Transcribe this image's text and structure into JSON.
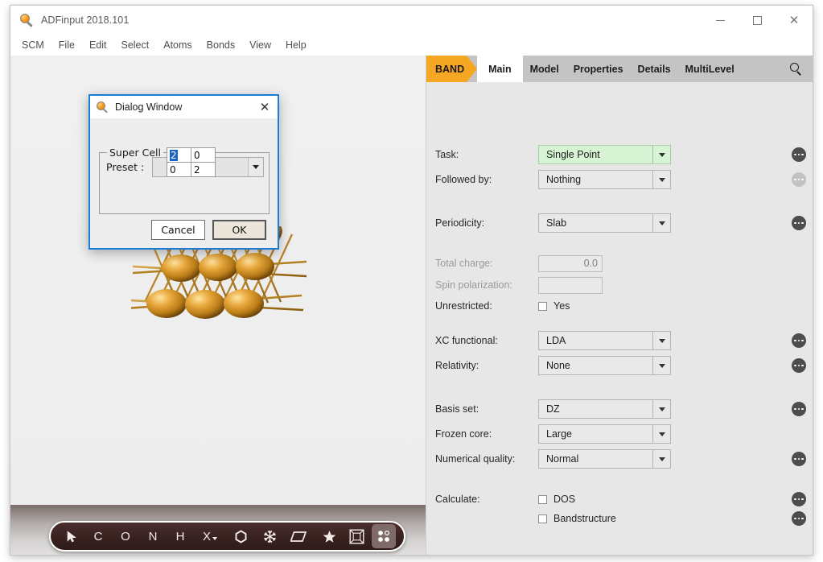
{
  "window": {
    "title": "ADFinput 2018.101",
    "icon": "magnifier-icon",
    "controls": {
      "minimize": "minimize-icon",
      "maximize": "maximize-icon",
      "close": "close-icon"
    }
  },
  "menubar": {
    "items": [
      {
        "label": "SCM"
      },
      {
        "label": "File"
      },
      {
        "label": "Edit"
      },
      {
        "label": "Select"
      },
      {
        "label": "Atoms"
      },
      {
        "label": "Bonds"
      },
      {
        "label": "View"
      },
      {
        "label": "Help"
      }
    ]
  },
  "viewer": {
    "toolbar": {
      "items": [
        {
          "name": "select-cursor-tool",
          "glyph": "➤",
          "kind": "cursor"
        },
        {
          "name": "carbon-tool",
          "glyph": "C",
          "kind": "letter"
        },
        {
          "name": "oxygen-tool",
          "glyph": "O",
          "kind": "letter"
        },
        {
          "name": "nitrogen-tool",
          "glyph": "N",
          "kind": "letter"
        },
        {
          "name": "hydrogen-tool",
          "glyph": "H",
          "kind": "letter"
        },
        {
          "name": "other-element-tool",
          "glyph": "X",
          "kind": "dropdown"
        },
        {
          "name": "ring-tool",
          "glyph": "⬡",
          "kind": "icon"
        },
        {
          "name": "snowflake-tool",
          "glyph": "❅",
          "kind": "icon"
        },
        {
          "name": "plane-tool",
          "glyph": "▱",
          "kind": "icon"
        },
        {
          "name": "star-tool",
          "glyph": "★",
          "kind": "right"
        },
        {
          "name": "unit-cell-tool",
          "glyph": "⛶",
          "kind": "right"
        },
        {
          "name": "supercell-tool",
          "glyph": "",
          "kind": "active-dots"
        }
      ]
    }
  },
  "settings": {
    "program_tab": "BAND",
    "tabs": [
      {
        "label": "Main",
        "active": true
      },
      {
        "label": "Model",
        "active": false
      },
      {
        "label": "Properties",
        "active": false
      },
      {
        "label": "Details",
        "active": false
      },
      {
        "label": "MultiLevel",
        "active": false
      }
    ],
    "search_icon": "search-icon",
    "fields": {
      "task": {
        "label": "Task:",
        "value": "Single Point",
        "highlight": "#d7f5d5"
      },
      "followed_by": {
        "label": "Followed by:",
        "value": "Nothing"
      },
      "periodicity": {
        "label": "Periodicity:",
        "value": "Slab"
      },
      "total_charge": {
        "label": "Total charge:",
        "value": "0.0"
      },
      "spin_polarization": {
        "label": "Spin polarization:",
        "value": ""
      },
      "unrestricted": {
        "label": "Unrestricted:",
        "checkbox_label": "Yes",
        "checked": false
      },
      "xc_functional": {
        "label": "XC functional:",
        "value": "LDA"
      },
      "relativity": {
        "label": "Relativity:",
        "value": "None"
      },
      "basis_set": {
        "label": "Basis set:",
        "value": "DZ"
      },
      "frozen_core": {
        "label": "Frozen core:",
        "value": "Large"
      },
      "numerical_quality": {
        "label": "Numerical quality:",
        "value": "Normal"
      },
      "calculate": {
        "label": "Calculate:",
        "options": [
          {
            "label": "DOS",
            "checked": false
          },
          {
            "label": "Bandstructure",
            "checked": false
          }
        ]
      }
    }
  },
  "dialog": {
    "title": "Dialog Window",
    "icon": "magnifier-icon",
    "close_icon": "close-icon",
    "group_legend": "Super Cell",
    "preset_label": "Preset :",
    "preset_value": "",
    "matrix": [
      [
        "2",
        "0"
      ],
      [
        "0",
        "2"
      ]
    ],
    "matrix_selected": {
      "row": 0,
      "col": 0
    },
    "buttons": {
      "cancel": "Cancel",
      "ok": "OK"
    }
  },
  "colors": {
    "accent_orange": "#f5a623",
    "dialog_border_blue": "#1a7fd4",
    "selection_blue": "#1a66c8",
    "green_field": "#d7f5d5",
    "panel_bg": "#e7e7e7",
    "tabbar_bg": "#c4c4c4",
    "toolbar_dark": "#3b2422"
  }
}
